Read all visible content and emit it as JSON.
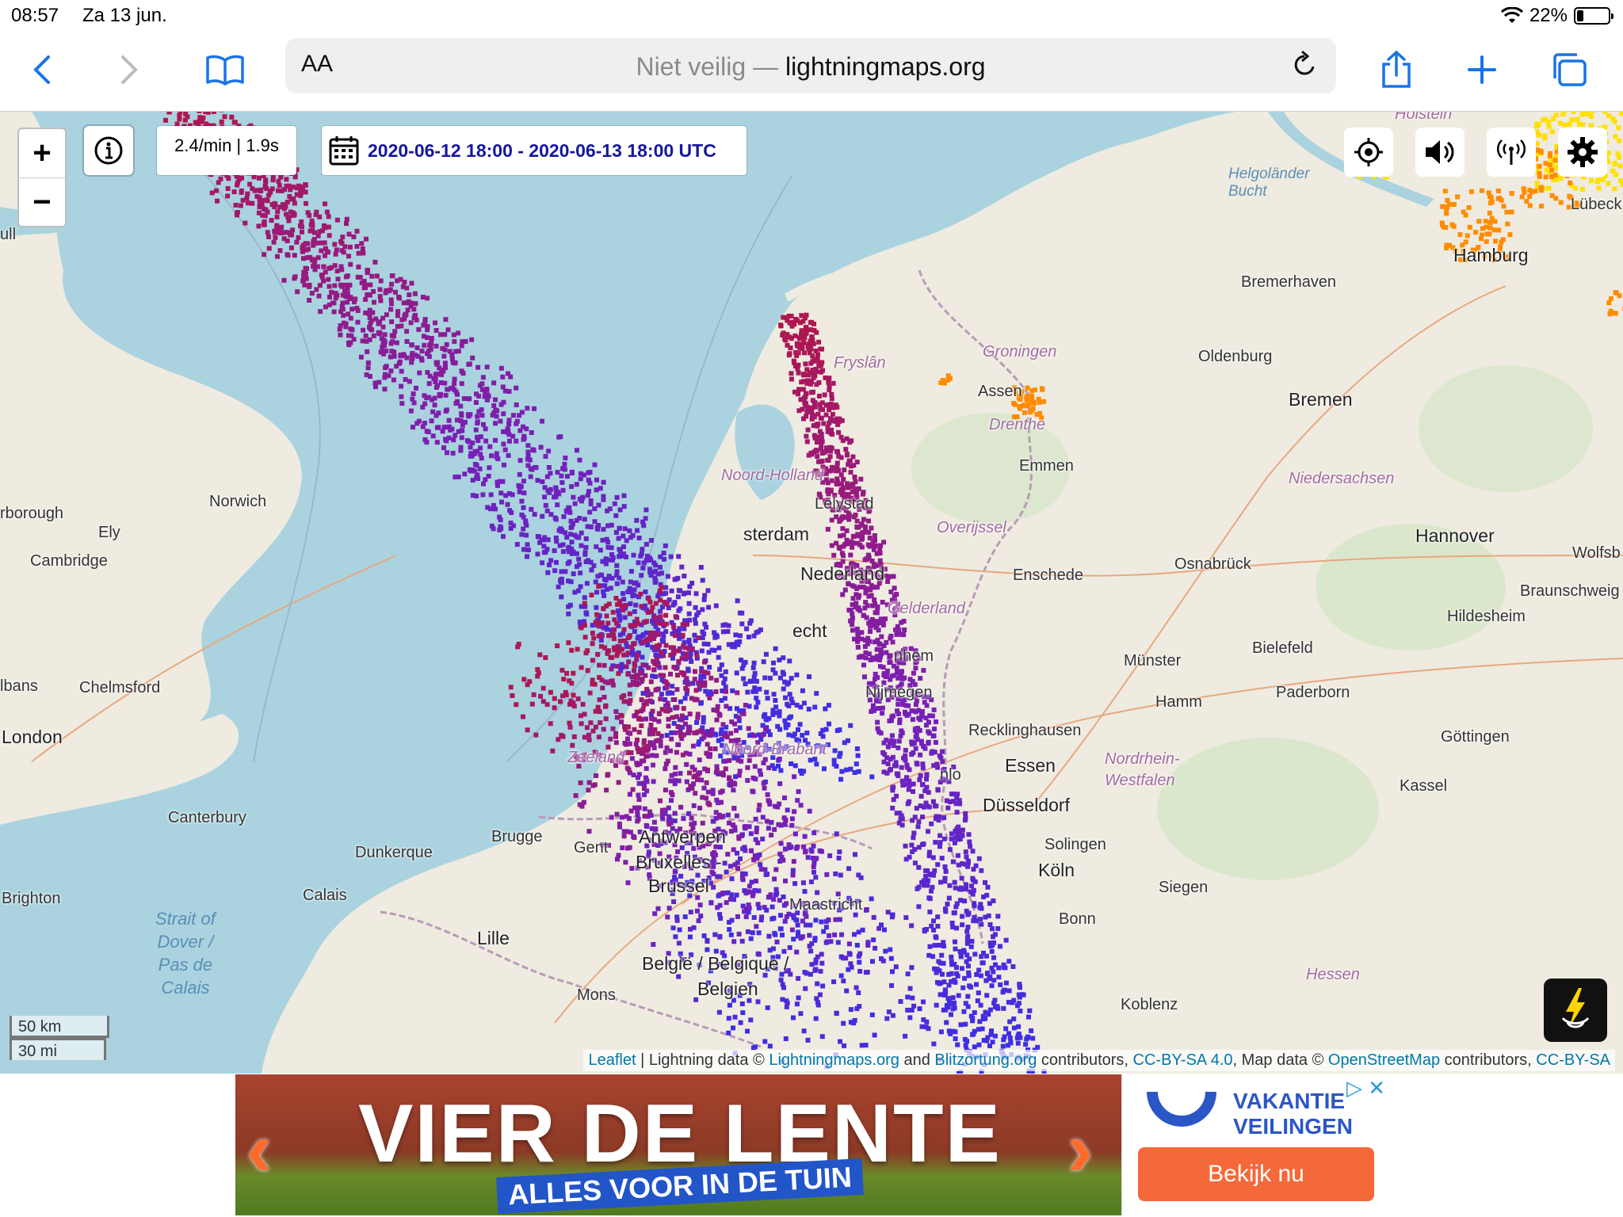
{
  "status_bar": {
    "time": "08:57",
    "date": "Za 13 jun.",
    "battery": "22%",
    "battery_level": 0.22
  },
  "browser": {
    "reader_label": "AA",
    "url_prefix": "Niet veilig —",
    "url_host": "lightningmaps.org"
  },
  "map": {
    "zoom_in": "+",
    "zoom_out": "−",
    "rate": "2.4/min | 1.9s",
    "date_range": "2020-06-12 18:00 - 2020-06-13 18:00 UTC",
    "scale_km": "50 km",
    "scale_mi": "30 mi",
    "attribution": {
      "leaflet": "Leaflet",
      "sep1": " | Lightning data © ",
      "lm": "Lightningmaps.org",
      "and": " and ",
      "blitz": "Blitzortung.org",
      "contrib1": " contributors, ",
      "ccbysa1": "CC-BY-SA 4.0",
      "mapdata": ", Map data © ",
      "osm": "OpenStreetMap",
      "contrib2": " contributors, ",
      "ccbysa2": "CC-BY-SA"
    },
    "places": {
      "london": "London",
      "norwich": "Norwich",
      "cambridge": "Cambridge",
      "ely": "Ely",
      "peterborough": "rborough",
      "chelmsford": "Chelmsford",
      "stalbans": "lbans",
      "hull": "ull",
      "canterbury": "Canterbury",
      "brighton": "Brighton",
      "calais": "Calais",
      "dunkerque": "Dunkerque",
      "brugge": "Brugge",
      "gent": "Gent",
      "antwerpen": "Antwerpen",
      "bruxelles": "Bruxelles -",
      "brussel": "Brussel",
      "lille": "Lille",
      "mons": "Mons",
      "belgie": "België / Belgique /",
      "belgien": "Belgien",
      "maastricht": "Maastricht",
      "zeeland": "Zeeland",
      "nbrabant": "Noord-Brabant",
      "amsterdam": "sterdam",
      "nederland": "Nederland",
      "utrecht": "echt",
      "nijmegen": "Nijmegen",
      "arnhem": "nhem",
      "gelderland": "Gelderland",
      "venlo": "nlo",
      "lelystad": "Lelystad",
      "noordholland": "Noord-Holland",
      "fryslan": "Fryslân",
      "groningen": "Groningen",
      "assen": "Assen",
      "drenthe": "Drenthe",
      "emmen": "Emmen",
      "overijssel": "Overijssel",
      "enschede": "Enschede",
      "oldenburg": "Oldenburg",
      "bremen": "Bremen",
      "bremerhaven": "Bremerhaven",
      "hamburg": "Hamburg",
      "lubeck": "Lübeck",
      "holstein": "Holstein",
      "helgoland": "Helgoländer\nBucht",
      "niedersachsen": "Niedersachsen",
      "hannover": "Hannover",
      "wolfsburg": "Wolfsb",
      "braunschweig": "Braunschweig",
      "hildesheim": "Hildesheim",
      "osnabruck": "Osnabrück",
      "bielefeld": "Bielefeld",
      "munster": "Münster",
      "paderborn": "Paderborn",
      "hamm": "Hamm",
      "recklinghausen": "Recklinghausen",
      "essen": "Essen",
      "nrw": "Nordrhein-\nWestfalen",
      "gottingen": "Göttingen",
      "kassel": "Kassel",
      "dusseldorf": "Düsseldorf",
      "solingen": "Solingen",
      "koln": "Köln",
      "siegen": "Siegen",
      "bonn": "Bonn",
      "koblenz": "Koblenz",
      "hessen": "Hessen",
      "dover": "Strait of\nDover /\nPas de\nCalais"
    },
    "strike_colors": {
      "old": "#b0164e",
      "mid": "#7a1fb4",
      "new": "#3a2fe8",
      "recent": "#ff8c00",
      "latest": "#ffe000"
    }
  },
  "ad": {
    "headline": "VIER DE LENTE",
    "subline": "ALLES VOOR IN DE TUIN",
    "prev": "‹",
    "next": "›",
    "brand_line1": "VAKANTIE",
    "brand_line2": "VEILINGEN",
    "cta": "Bekijk nu",
    "close": "▷ ✕"
  }
}
